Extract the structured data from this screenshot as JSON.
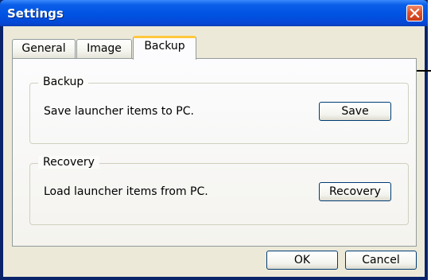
{
  "window": {
    "title": "Settings"
  },
  "tabs": [
    {
      "label": "General",
      "active": false
    },
    {
      "label": "Image",
      "active": false
    },
    {
      "label": "Backup",
      "active": true
    }
  ],
  "backup_group": {
    "title": "Backup",
    "description": "Save launcher items to PC.",
    "button_label": "Save"
  },
  "recovery_group": {
    "title": "Recovery",
    "description": "Load launcher items from PC.",
    "button_label": "Recovery"
  },
  "footer": {
    "ok_label": "OK",
    "cancel_label": "Cancel"
  },
  "icons": {
    "close": "close-icon"
  },
  "colors": {
    "titlebar": "#0053e3",
    "client_bg": "#ece9d8",
    "active_tab_accent": "#ffc83c",
    "close_button": "#e2512a"
  }
}
